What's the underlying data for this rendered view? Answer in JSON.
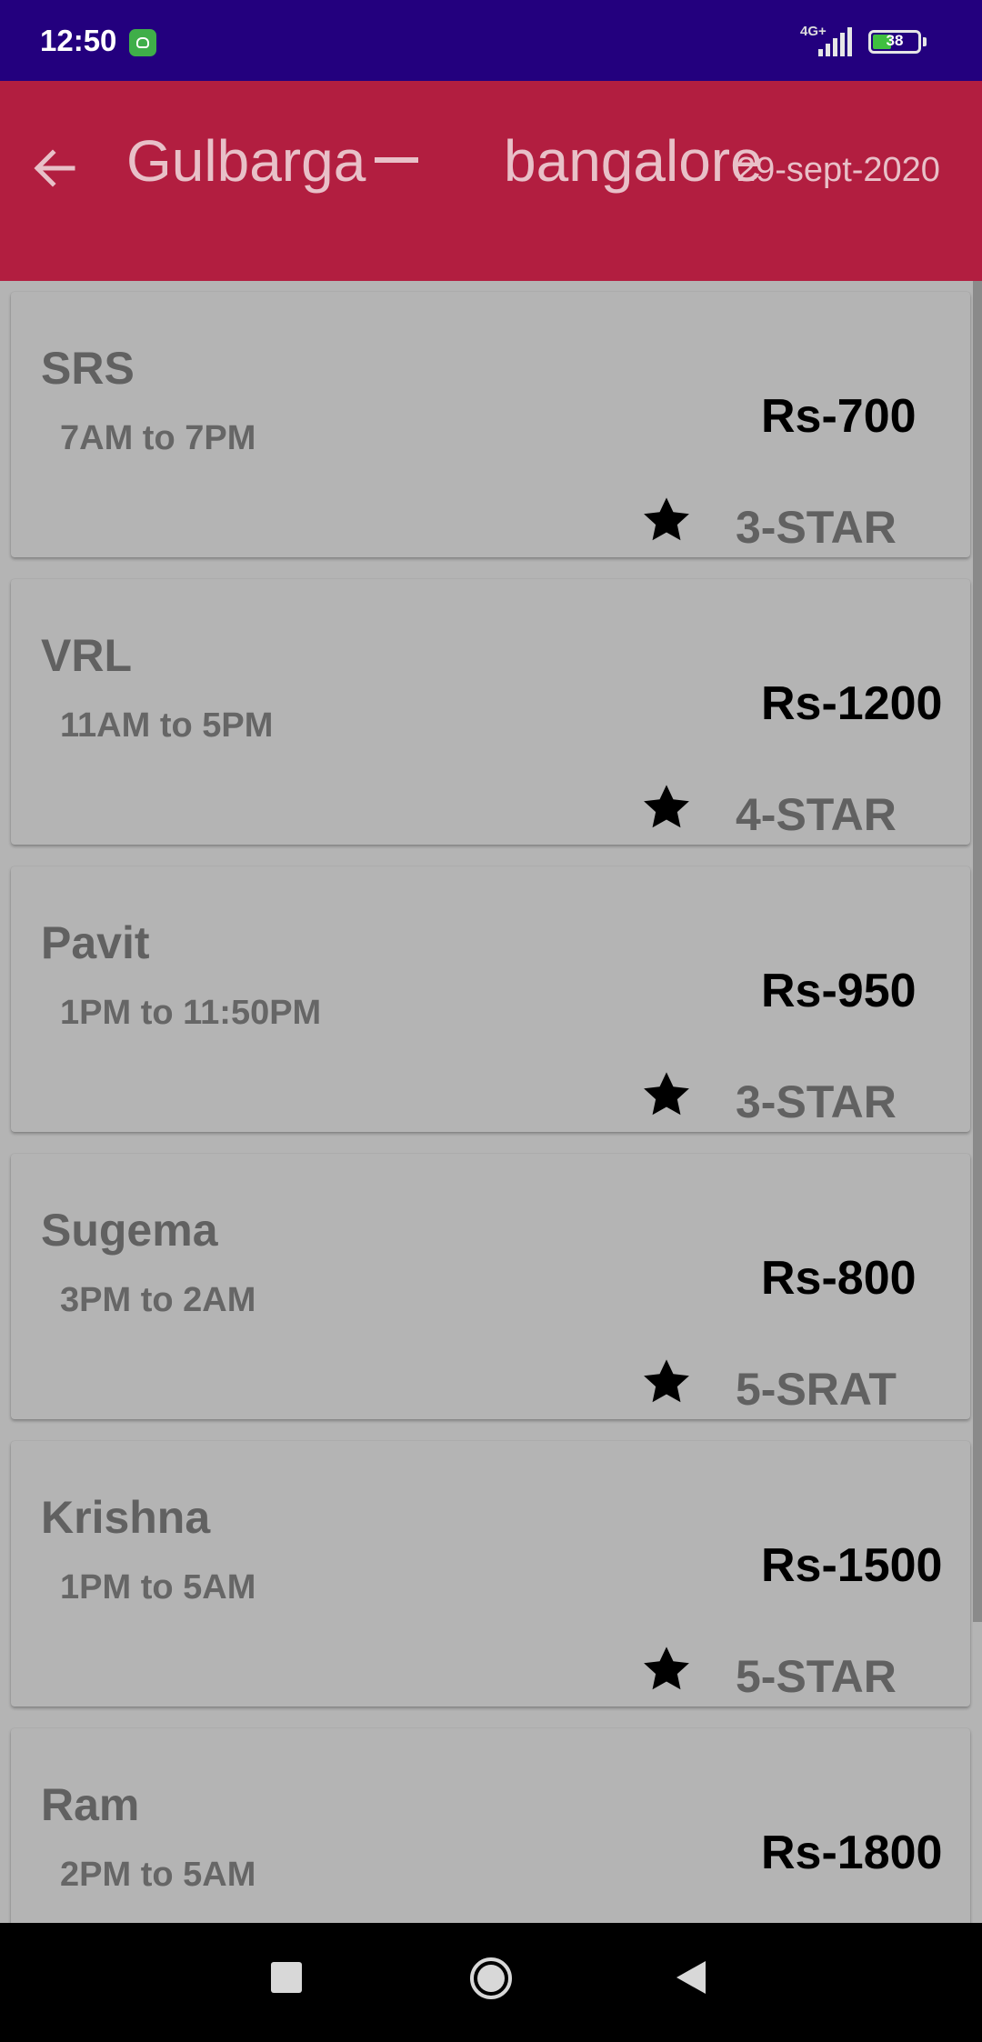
{
  "status_bar": {
    "time": "12:50",
    "network": "4G+",
    "battery": "38",
    "icons": [
      "app-notification-icon",
      "signal-icon",
      "battery-icon"
    ]
  },
  "toolbar": {
    "from": "Gulbarga",
    "to": "bangalore",
    "date": "29-sept-2020",
    "back_icon": "arrow-back-icon",
    "colors": {
      "background": "#b21e40",
      "text": "#e8c0c8"
    }
  },
  "buses": [
    {
      "name": "SRS",
      "time": "7AM to 7PM",
      "price": "Rs-700",
      "rating": "3-STAR"
    },
    {
      "name": "VRL",
      "time": "11AM to 5PM",
      "price": "Rs-1200",
      "rating": "4-STAR"
    },
    {
      "name": "Pavit",
      "time": "1PM to 11:50PM",
      "price": "Rs-950",
      "rating": "3-STAR"
    },
    {
      "name": "Sugema",
      "time": "3PM to 2AM",
      "price": "Rs-800",
      "rating": "5-SRAT"
    },
    {
      "name": "Krishna",
      "time": "1PM to 5AM",
      "price": "Rs-1500",
      "rating": "5-STAR"
    },
    {
      "name": "Ram",
      "time": "2PM to 5AM",
      "price": "Rs-1800",
      "rating": ""
    }
  ],
  "nav_bar": {
    "icons": [
      "recents-icon",
      "home-icon",
      "back-icon"
    ]
  },
  "colors": {
    "status_bar": "#23007e",
    "card": "#b4b4b4",
    "star": "#000000"
  }
}
